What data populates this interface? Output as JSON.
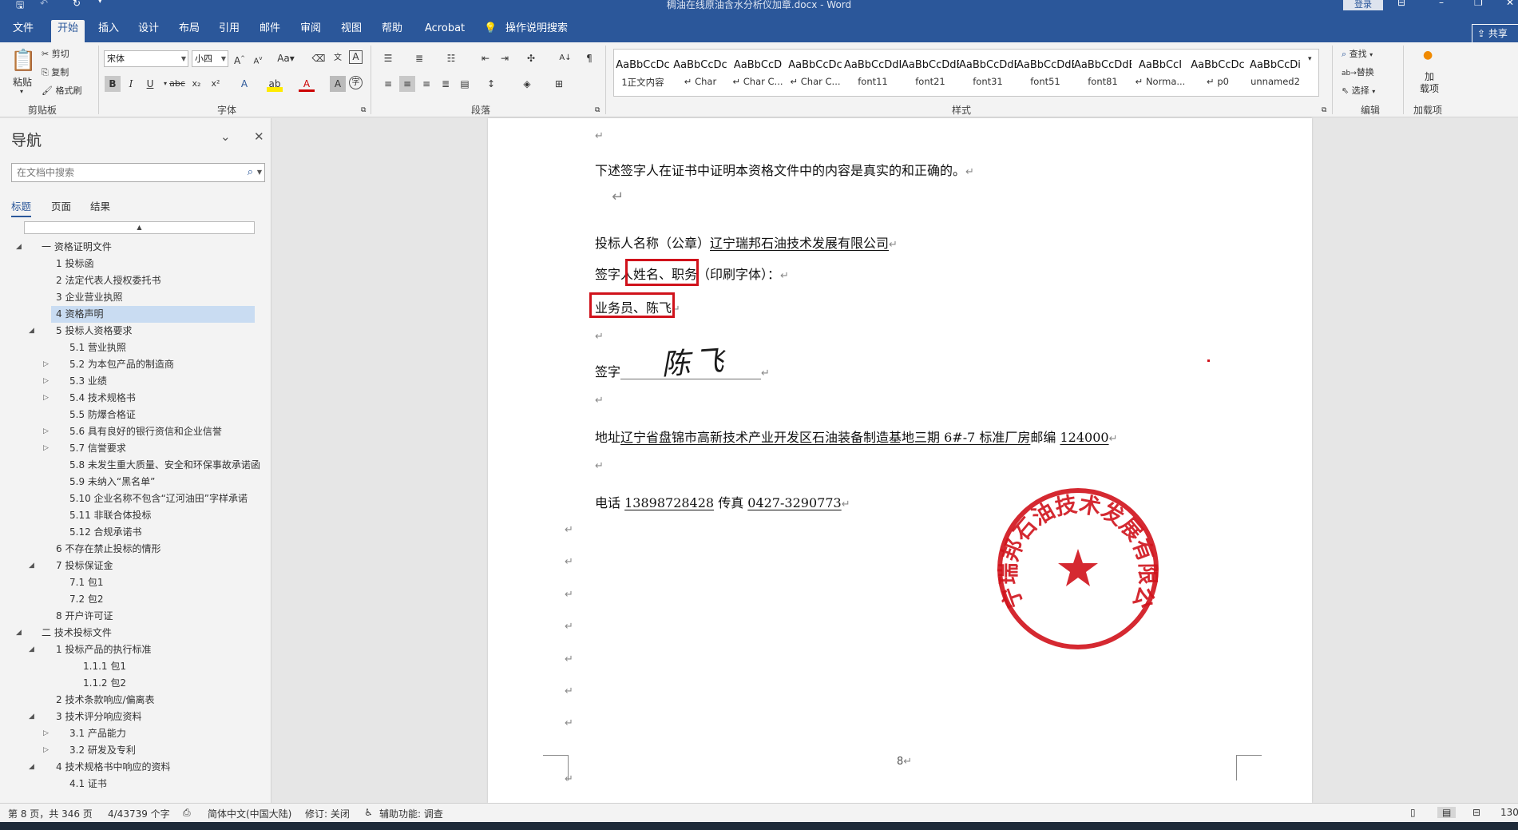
{
  "titlebar": {
    "doc_title": "稠油在线原油含水分析仪加章.docx  -  Word",
    "login_label": "登录",
    "save_icon": "save-icon",
    "undo_icon": "undo-icon",
    "refresh_icon": "refresh-icon",
    "customize_icon": "qat-dropdown-icon"
  },
  "menu": {
    "tabs": [
      "文件",
      "开始",
      "插入",
      "设计",
      "布局",
      "引用",
      "邮件",
      "审阅",
      "视图",
      "帮助",
      "Acrobat",
      "操作说明搜索"
    ],
    "active_tab": "开始",
    "share_label": "共享"
  },
  "ribbon": {
    "clipboard": {
      "paste": "粘贴",
      "cut": "剪切",
      "copy": "复制",
      "format_painter": "格式刷",
      "group": "剪贴板"
    },
    "font": {
      "font_name": "宋体",
      "font_size": "小四",
      "group": "字体"
    },
    "paragraph": {
      "group": "段落"
    },
    "styles": {
      "group": "样式",
      "items": [
        {
          "sample": "AaBbCcDc",
          "name": "1正文内容"
        },
        {
          "sample": "AaBbCcDc",
          "name": "↵ Char"
        },
        {
          "sample": "AaBbCcD",
          "name": "↵ Char C..."
        },
        {
          "sample": "AaBbCcDc",
          "name": "↵ Char C..."
        },
        {
          "sample": "AaBbCcDdI",
          "name": "font11"
        },
        {
          "sample": "AaBbCcDdE",
          "name": "font21"
        },
        {
          "sample": "AaBbCcDdEe",
          "name": "font31"
        },
        {
          "sample": "AaBbCcDdEe",
          "name": "font51"
        },
        {
          "sample": "AaBbCcDdEe",
          "name": "font81"
        },
        {
          "sample": "AaBbCcI",
          "name": "↵ Norma..."
        },
        {
          "sample": "AaBbCcDc",
          "name": "↵ p0"
        },
        {
          "sample": "AaBbCcDi",
          "name": "unnamed2"
        }
      ]
    },
    "editing": {
      "find": "查找",
      "replace": "替换",
      "select": "选择",
      "group": "编辑"
    },
    "addins": {
      "load": "加\n载项",
      "group": "加载项"
    }
  },
  "nav": {
    "title": "导航",
    "search_placeholder": "在文档中搜索",
    "tabs": [
      "标题",
      "页面",
      "结果"
    ],
    "active_tab": "标题",
    "items": [
      {
        "label": "一 资格证明文件",
        "level": 0,
        "toggle": "expanded"
      },
      {
        "label": "1 投标函",
        "level": 1,
        "toggle": "none"
      },
      {
        "label": "2 法定代表人授权委托书",
        "level": 1,
        "toggle": "none"
      },
      {
        "label": "3 企业营业执照",
        "level": 1,
        "toggle": "none"
      },
      {
        "label": "4 资格声明",
        "level": 1,
        "toggle": "none",
        "selected": true
      },
      {
        "label": "5 投标人资格要求",
        "level": 1,
        "toggle": "expanded"
      },
      {
        "label": "5.1 营业执照",
        "level": 2,
        "toggle": "none"
      },
      {
        "label": "5.2 为本包产品的制造商",
        "level": 2,
        "toggle": "collapsed"
      },
      {
        "label": "5.3 业绩",
        "level": 2,
        "toggle": "collapsed"
      },
      {
        "label": "5.4 技术规格书",
        "level": 2,
        "toggle": "collapsed"
      },
      {
        "label": "5.5 防爆合格证",
        "level": 2,
        "toggle": "none"
      },
      {
        "label": "5.6 具有良好的银行资信和企业信誉",
        "level": 2,
        "toggle": "collapsed"
      },
      {
        "label": "5.7 信誉要求",
        "level": 2,
        "toggle": "collapsed"
      },
      {
        "label": "5.8 未发生重大质量、安全和环保事故承诺函",
        "level": 2,
        "toggle": "none"
      },
      {
        "label": "5.9 未纳入“黑名单”",
        "level": 2,
        "toggle": "none"
      },
      {
        "label": "5.10 企业名称不包含“辽河油田”字样承诺",
        "level": 2,
        "toggle": "none"
      },
      {
        "label": "5.11 非联合体投标",
        "level": 2,
        "toggle": "none"
      },
      {
        "label": "5.12 合规承诺书",
        "level": 2,
        "toggle": "none"
      },
      {
        "label": "6 不存在禁止投标的情形",
        "level": 1,
        "toggle": "none"
      },
      {
        "label": "7 投标保证金",
        "level": 1,
        "toggle": "expanded"
      },
      {
        "label": "7.1 包1",
        "level": 2,
        "toggle": "none"
      },
      {
        "label": "7.2 包2",
        "level": 2,
        "toggle": "none"
      },
      {
        "label": "8 开户许可证",
        "level": 1,
        "toggle": "none"
      },
      {
        "label": "二 技术投标文件",
        "level": 0,
        "toggle": "expanded"
      },
      {
        "label": "1 投标产品的执行标准",
        "level": 1,
        "toggle": "expanded"
      },
      {
        "label": "1.1.1 包1",
        "level": 3,
        "toggle": "none"
      },
      {
        "label": "1.1.2 包2",
        "level": 3,
        "toggle": "none"
      },
      {
        "label": "2 技术条款响应/偏离表",
        "level": 1,
        "toggle": "none"
      },
      {
        "label": "3 技术评分响应资料",
        "level": 1,
        "toggle": "expanded"
      },
      {
        "label": "3.1 产品能力",
        "level": 2,
        "toggle": "collapsed"
      },
      {
        "label": "3.2 研发及专利",
        "level": 2,
        "toggle": "collapsed"
      },
      {
        "label": "4 技术规格书中响应的资料",
        "level": 1,
        "toggle": "expanded"
      },
      {
        "label": "4.1 证书",
        "level": 2,
        "toggle": "none"
      }
    ]
  },
  "document": {
    "declaration": "下述签字人在证书中证明本资格文件中的内容是真实的和正确的。",
    "bidder_label": "投标人名称（公章）",
    "bidder_name": "辽宁瑞邦石油技术发展有限公司",
    "signer_prefix": "签字人",
    "signer_highlight": "姓名、职务",
    "signer_suffix": "（印刷字体）：",
    "signer_value": "业务员、陈飞",
    "sign_label": "签字",
    "sign_line": "______________________",
    "signature_text": "陈飞",
    "address_label": "地址",
    "address_value": "辽宁省盘锦市高新技术产业开发区石油装备制造基地三期 6#-7 标准厂房",
    "postcode_label": "邮编",
    "postcode_value": "124000",
    "phone_label": "电话",
    "phone_value": "13898728428",
    "fax_label": "传真",
    "fax_value": "0427-3290773",
    "seal_text": "辽宁瑞邦石油技术发展有限公司",
    "page_number": "8",
    "para_mark": "↵"
  },
  "status": {
    "page": "第 8 页，共 346 页",
    "words": "4/43739 个字",
    "lang": "简体中文(中国大陆)",
    "track": "修订: 关闭",
    "access": "辅助功能: 调查",
    "zoom": "130"
  },
  "colors": {
    "brand": "#2b579a",
    "seal": "#d0121b",
    "selection": "#c9dcf2"
  }
}
